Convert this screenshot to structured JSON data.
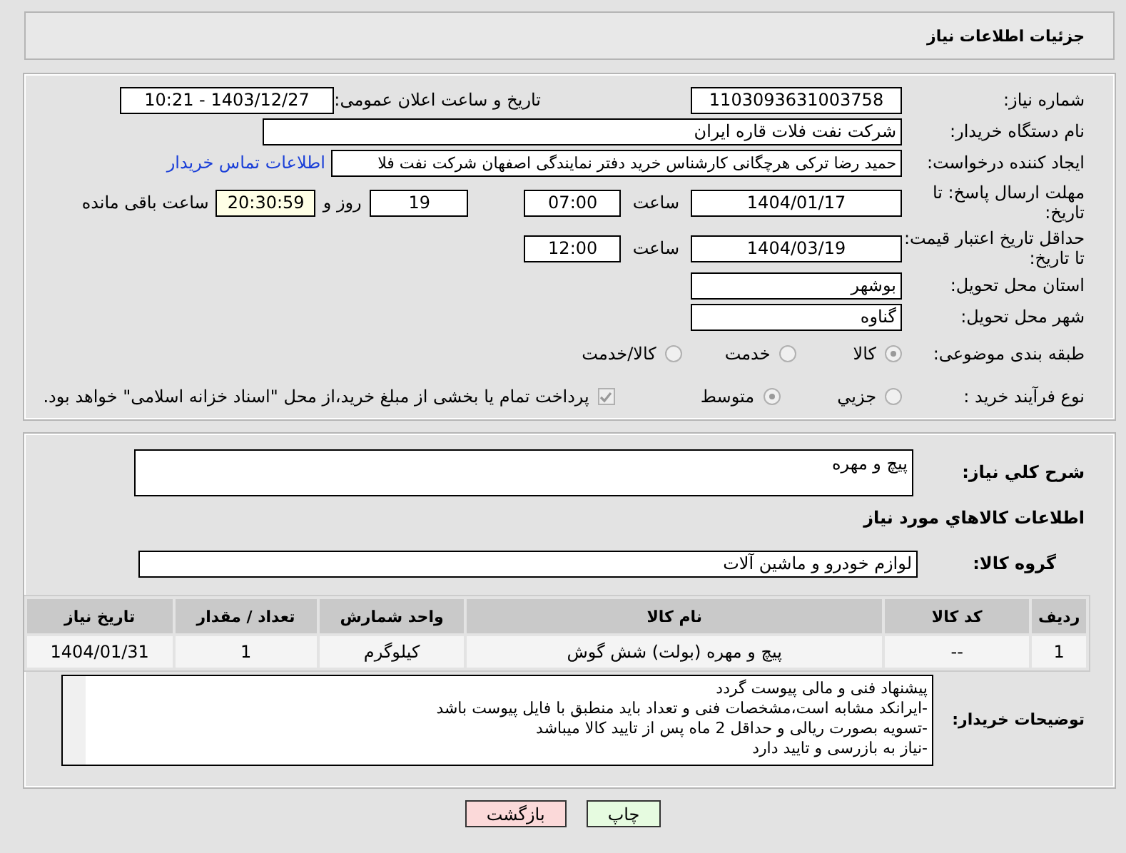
{
  "header": {
    "title": "جزئیات اطلاعات نیاز"
  },
  "need_number": {
    "label": "شماره نیاز:",
    "value": "1103093631003758"
  },
  "announce": {
    "label": "تاریخ و ساعت اعلان عمومی:",
    "value": "1403/12/27 - 10:21"
  },
  "buyer": {
    "label": "نام دستگاه خریدار:",
    "value": "شرکت نفت فلات قاره ایران"
  },
  "creator": {
    "label": "ایجاد کننده درخواست:",
    "value": "حمید رضا ترکی هرچگانی کارشناس خرید دفتر نمایندگی اصفهان شرکت نفت فلا",
    "link": "اطلاعات تماس خریدار"
  },
  "deadline": {
    "label": "مهلت ارسال پاسخ: تا تاریخ:",
    "date": "1404/01/17",
    "time_label": "ساعت",
    "time": "07:00",
    "days": "19",
    "days_label": "روز و",
    "remaining": "20:30:59",
    "remaining_label": "ساعت باقی مانده"
  },
  "validity": {
    "label": "حداقل تاریخ اعتبار قیمت: تا تاریخ:",
    "date": "1404/03/19",
    "time_label": "ساعت",
    "time": "12:00"
  },
  "province": {
    "label": "استان محل تحویل:",
    "value": "بوشهر"
  },
  "city": {
    "label": "شهر محل تحویل:",
    "value": "گناوه"
  },
  "category": {
    "label": "طبقه بندی موضوعی:",
    "options": [
      {
        "label": "کالا",
        "selected": true
      },
      {
        "label": "خدمت",
        "selected": false
      },
      {
        "label": "کالا/خدمت",
        "selected": false
      }
    ]
  },
  "process": {
    "label": "نوع فرآیند خرید :",
    "options": [
      {
        "label": "جزیي",
        "selected": false
      },
      {
        "label": "متوسط",
        "selected": true
      }
    ],
    "payment": {
      "label": "پرداخت تمام یا بخشی از مبلغ خرید،از محل \"اسناد خزانه اسلامی\" خواهد بود.",
      "checked": true
    }
  },
  "description": {
    "label": "شرح کلي نیاز:",
    "value": "پیچ و مهره"
  },
  "items_heading": "اطلاعات کالاهاي مورد نیاز",
  "group": {
    "label": "گروه کالا:",
    "value": "لوازم خودرو و ماشین آلات"
  },
  "table": {
    "columns": [
      "ردیف",
      "کد کالا",
      "نام کالا",
      "واحد شمارش",
      "تعداد / مقدار",
      "تاریخ نیاز"
    ],
    "rows": [
      [
        "1",
        "--",
        "پیچ و مهره (بولت) شش گوش",
        "کیلوگرم",
        "1",
        "1404/01/31"
      ]
    ]
  },
  "notes": {
    "label": "توضیحات خریدار:",
    "lines": [
      "پیشنهاد فنی و مالی پیوست گردد",
      "-ایرانکد مشابه است،مشخصات فنی و تعداد باید منطبق با فایل پیوست باشد",
      "-تسویه بصورت ریالی و حداقل 2 ماه پس از تایید کالا میباشد",
      "-نیاز به بازرسی و تایید دارد"
    ]
  },
  "buttons": [
    {
      "label": "چاپ",
      "kind": "print"
    },
    {
      "label": "بازگشت",
      "kind": "back"
    }
  ]
}
